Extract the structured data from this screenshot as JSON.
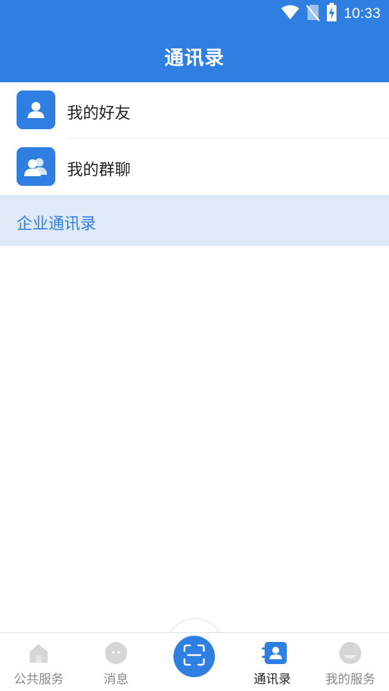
{
  "status_bar": {
    "time": "10:33",
    "icons": [
      "wifi-icon",
      "no-sim-icon",
      "battery-charging-icon"
    ]
  },
  "header": {
    "title": "通讯录"
  },
  "list": {
    "items": [
      {
        "label": "我的好友",
        "icon": "user-icon"
      },
      {
        "label": "我的群聊",
        "icon": "group-icon"
      }
    ]
  },
  "section": {
    "title": "企业通讯录"
  },
  "tabbar": {
    "tabs": [
      {
        "label": "公共服务",
        "icon": "home-icon",
        "active": false
      },
      {
        "label": "消息",
        "icon": "chat-icon",
        "active": false
      },
      {
        "label": "",
        "icon": "scan-icon",
        "active": false
      },
      {
        "label": "通讯录",
        "icon": "contacts-icon",
        "active": true
      },
      {
        "label": "我的服务",
        "icon": "profile-icon",
        "active": false
      }
    ]
  },
  "colors": {
    "primary": "#2f7ee2",
    "section_bg": "#dfe9f7",
    "inactive_icon": "#d6d6d6",
    "inactive_text": "#888888"
  }
}
